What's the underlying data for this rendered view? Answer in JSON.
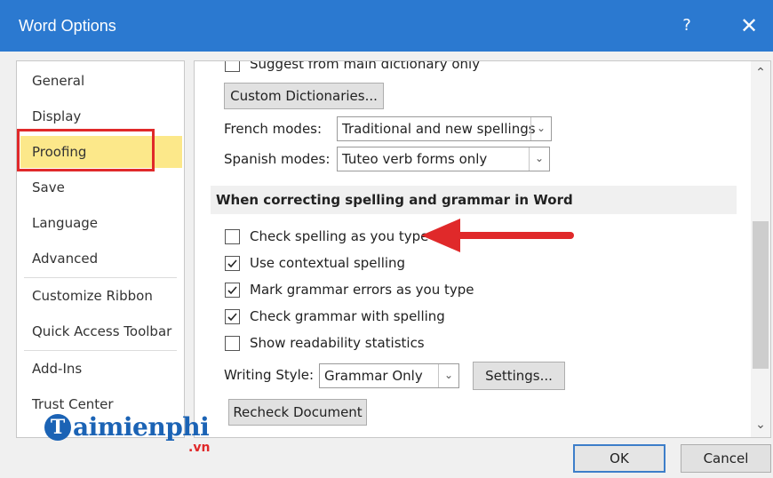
{
  "window": {
    "title": "Word Options",
    "help": "?",
    "close": "✕"
  },
  "nav": {
    "items": [
      {
        "label": "General"
      },
      {
        "label": "Display"
      },
      {
        "label": "Proofing",
        "selected": true
      },
      {
        "label": "Save"
      },
      {
        "label": "Language"
      },
      {
        "label": "Advanced"
      },
      {
        "label": "Customize Ribbon"
      },
      {
        "label": "Quick Access Toolbar"
      },
      {
        "label": "Add-Ins"
      },
      {
        "label": "Trust Center"
      }
    ]
  },
  "content": {
    "suggest_main": {
      "label": "Suggest from main dictionary only",
      "checked": false
    },
    "custom_dictionaries": "Custom Dictionaries...",
    "french_modes": {
      "label": "French modes:",
      "value": "Traditional and new spellings"
    },
    "spanish_modes": {
      "label": "Spanish modes:",
      "value": "Tuteo verb forms only"
    },
    "section_title": "When correcting spelling and grammar in Word",
    "checkboxes": [
      {
        "label": "Check spelling as you type",
        "checked": false
      },
      {
        "label": "Use contextual spelling",
        "checked": true
      },
      {
        "label": "Mark grammar errors as you type",
        "checked": true
      },
      {
        "label": "Check grammar with spelling",
        "checked": true
      },
      {
        "label": "Show readability statistics",
        "checked": false
      }
    ],
    "writing_style": {
      "label": "Writing Style:",
      "value": "Grammar Only"
    },
    "settings": "Settings...",
    "recheck": "Recheck Document"
  },
  "buttons": {
    "ok": "OK",
    "cancel": "Cancel"
  },
  "watermark": {
    "brand": "aimienphi",
    "initial": "T",
    "suffix": ".vn"
  },
  "colors": {
    "titlebar": "#2b79d0",
    "selected": "#fce88a",
    "highlight": "#e0292a"
  }
}
